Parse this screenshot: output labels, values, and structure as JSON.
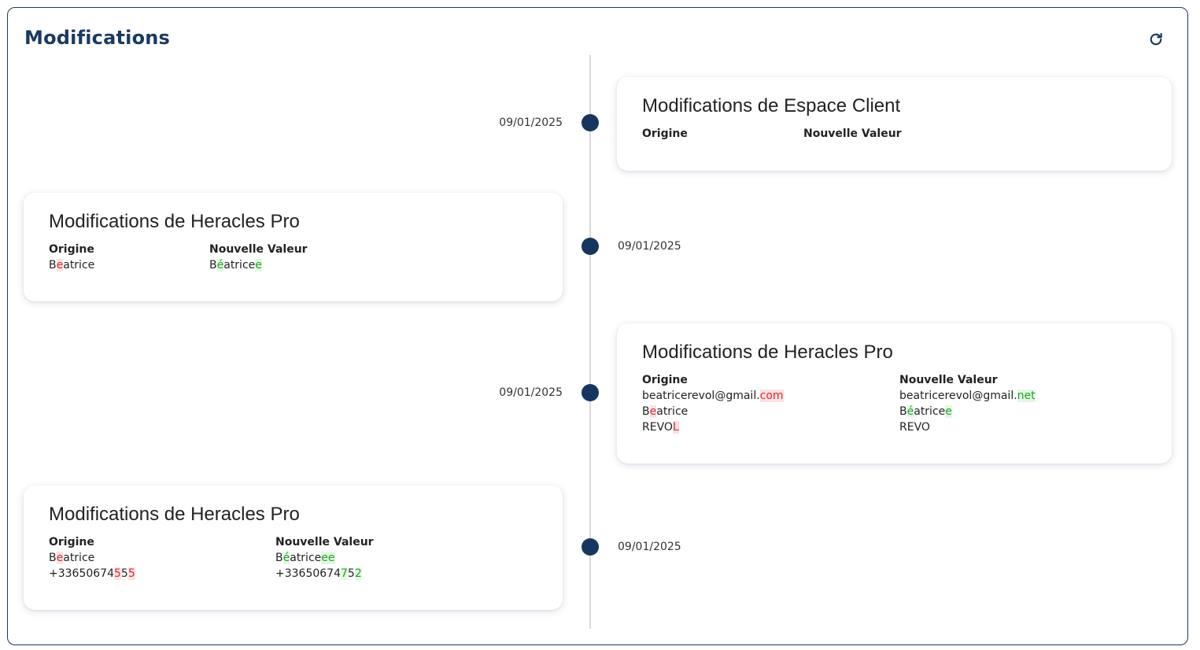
{
  "header": {
    "title": "Modifications",
    "refresh_icon": "refresh-icon"
  },
  "colors": {
    "accent": "#1b3a60",
    "deleted_text": "#e0282e",
    "deleted_bg": "#fde2e2",
    "inserted_text": "#1fa526",
    "inserted_bg": "#e3f8e3"
  },
  "entries": [
    {
      "date": "09/01/2025",
      "title": "Modifications de Espace Client",
      "origin_label": "Origine",
      "new_label": "Nouvelle Valeur"
    },
    {
      "date": "09/01/2025",
      "title": "Modifications de Heracles Pro",
      "origin_label": "Origine",
      "new_label": "Nouvelle Valeur",
      "rows": [
        {
          "origin": [
            {
              "t": "B"
            },
            {
              "t": "e",
              "del": true
            },
            {
              "t": "atrice"
            }
          ],
          "new": [
            {
              "t": "B"
            },
            {
              "t": "é",
              "ins": true
            },
            {
              "t": "atrice"
            },
            {
              "t": "e",
              "ins": true
            }
          ]
        }
      ]
    },
    {
      "date": "09/01/2025",
      "title": "Modifications de Heracles Pro",
      "origin_label": "Origine",
      "new_label": "Nouvelle Valeur",
      "rows": [
        {
          "origin": [
            {
              "t": "beatricerevol@gmail."
            },
            {
              "t": "com",
              "del": true
            }
          ],
          "new": [
            {
              "t": "beatricerevol@gmail."
            },
            {
              "t": "net",
              "ins": true
            }
          ]
        },
        {
          "origin": [
            {
              "t": "B"
            },
            {
              "t": "e",
              "del": true
            },
            {
              "t": "atrice"
            }
          ],
          "new": [
            {
              "t": "B"
            },
            {
              "t": "é",
              "ins": true
            },
            {
              "t": "atrice"
            },
            {
              "t": "e",
              "ins": true
            }
          ]
        },
        {
          "origin": [
            {
              "t": "REVO"
            },
            {
              "t": "L",
              "del": true
            }
          ],
          "new": [
            {
              "t": "REVO"
            }
          ]
        }
      ]
    },
    {
      "date": "09/01/2025",
      "title": "Modifications de Heracles Pro",
      "origin_label": "Origine",
      "new_label": "Nouvelle Valeur",
      "rows": [
        {
          "origin": [
            {
              "t": "B"
            },
            {
              "t": "e",
              "del": true
            },
            {
              "t": "atrice"
            }
          ],
          "new": [
            {
              "t": "B"
            },
            {
              "t": "é",
              "ins": true
            },
            {
              "t": "atrice"
            },
            {
              "t": "ee",
              "ins": true
            }
          ]
        },
        {
          "origin": [
            {
              "t": "+33650674"
            },
            {
              "t": "5",
              "del": true
            },
            {
              "t": "5"
            },
            {
              "t": "5",
              "del": true
            }
          ],
          "new": [
            {
              "t": "+33650674"
            },
            {
              "t": "7",
              "ins": true
            },
            {
              "t": "5"
            },
            {
              "t": "2",
              "ins": true
            }
          ]
        }
      ]
    }
  ]
}
